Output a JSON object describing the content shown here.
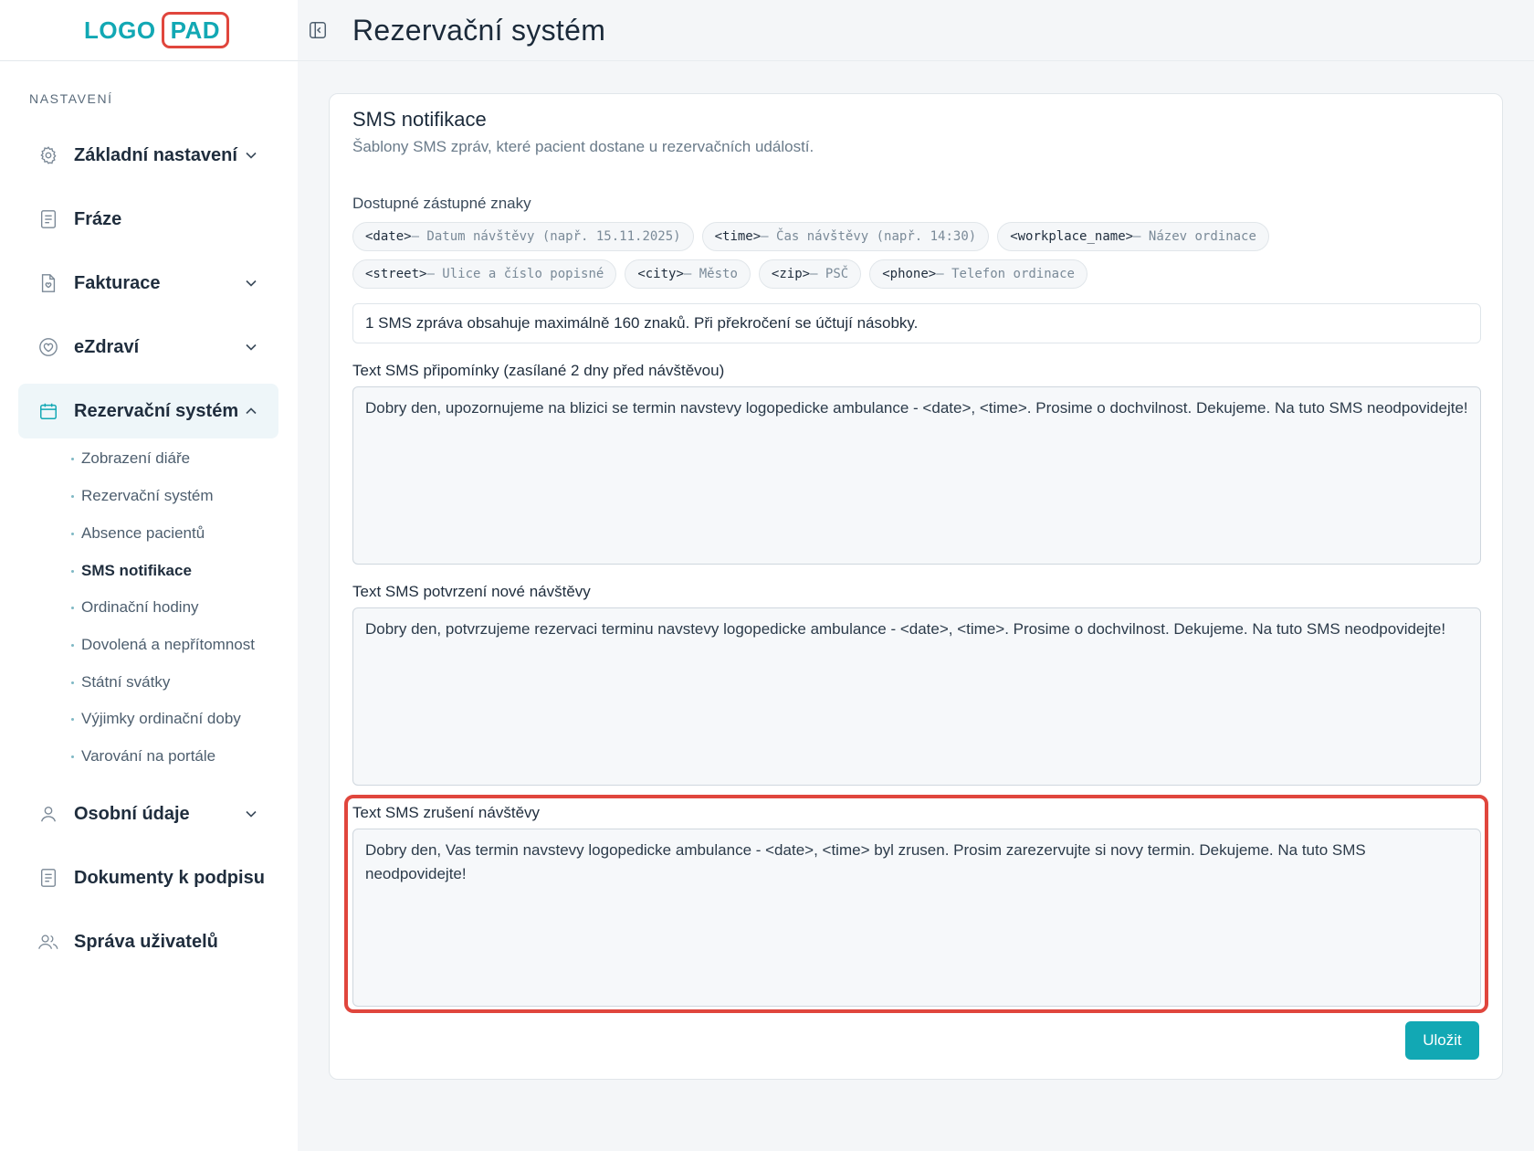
{
  "logo": {
    "part_a": "LOGO",
    "part_b": "PAD"
  },
  "header": {
    "title": "Rezervační systém"
  },
  "sidebar": {
    "section_title": "NASTAVENÍ",
    "items": [
      {
        "label": "Základní nastavení",
        "icon": "gear-icon"
      },
      {
        "label": "Fráze",
        "icon": "document-icon"
      },
      {
        "label": "Fakturace",
        "icon": "invoice-icon"
      },
      {
        "label": "eZdraví",
        "icon": "heart-icon"
      },
      {
        "label": "Rezervační systém",
        "icon": "calendar-icon"
      },
      {
        "label": "Osobní údaje",
        "icon": "user-icon"
      },
      {
        "label": "Dokumenty k podpisu",
        "icon": "document-icon"
      },
      {
        "label": "Správa uživatelů",
        "icon": "users-icon"
      }
    ],
    "subitems": [
      "Zobrazení diáře",
      "Rezervační systém",
      "Absence pacientů",
      "SMS notifikace",
      "Ordinační hodiny",
      "Dovolená a nepřítomnost",
      "Státní svátky",
      "Výjimky ordinační doby",
      "Varování na portále"
    ]
  },
  "card": {
    "title": "SMS notifikace",
    "subtitle": "Šablony SMS zpráv, které pacient dostane u rezervačních událostí.",
    "placeholders_label": "Dostupné zástupné znaky",
    "placeholders": [
      {
        "key": "<date>",
        "desc": " – Datum návštěvy (např. 15.11.2025)"
      },
      {
        "key": "<time>",
        "desc": " – Čas návštěvy (např. 14:30)"
      },
      {
        "key": "<workplace_name>",
        "desc": " – Název ordinace"
      },
      {
        "key": "<street>",
        "desc": " – Ulice a číslo popisné"
      },
      {
        "key": "<city>",
        "desc": " – Město"
      },
      {
        "key": "<zip>",
        "desc": " – PSČ"
      },
      {
        "key": "<phone>",
        "desc": " – Telefon ordinace"
      }
    ],
    "info": "1 SMS zpráva obsahuje maximálně 160 znaků. Při překročení se účtují násobky.",
    "reminder_label": "Text SMS připomínky (zasílané 2 dny před návštěvou)",
    "reminder_text": "Dobry den, upozornujeme na blizici se termin navstevy logopedicke ambulance - <date>, <time>. Prosime o dochvilnost. Dekujeme. Na tuto SMS neodpovidejte!",
    "confirm_label": "Text SMS potvrzení nové návštěvy",
    "confirm_text": "Dobry den, potvrzujeme rezervaci terminu navstevy logopedicke ambulance - <date>, <time>. Prosime o dochvilnost. Dekujeme. Na tuto SMS neodpovidejte!",
    "cancel_label": "Text SMS zrušení návštěvy",
    "cancel_text": "Dobry den, Vas termin navstevy logopedicke ambulance - <date>, <time> byl zrusen. Prosim zarezervujte si novy termin. Dekujeme. Na tuto SMS neodpovidejte!",
    "save_label": "Uložit"
  },
  "colors": {
    "accent": "#12a8b4",
    "highlight": "#e0463d"
  }
}
